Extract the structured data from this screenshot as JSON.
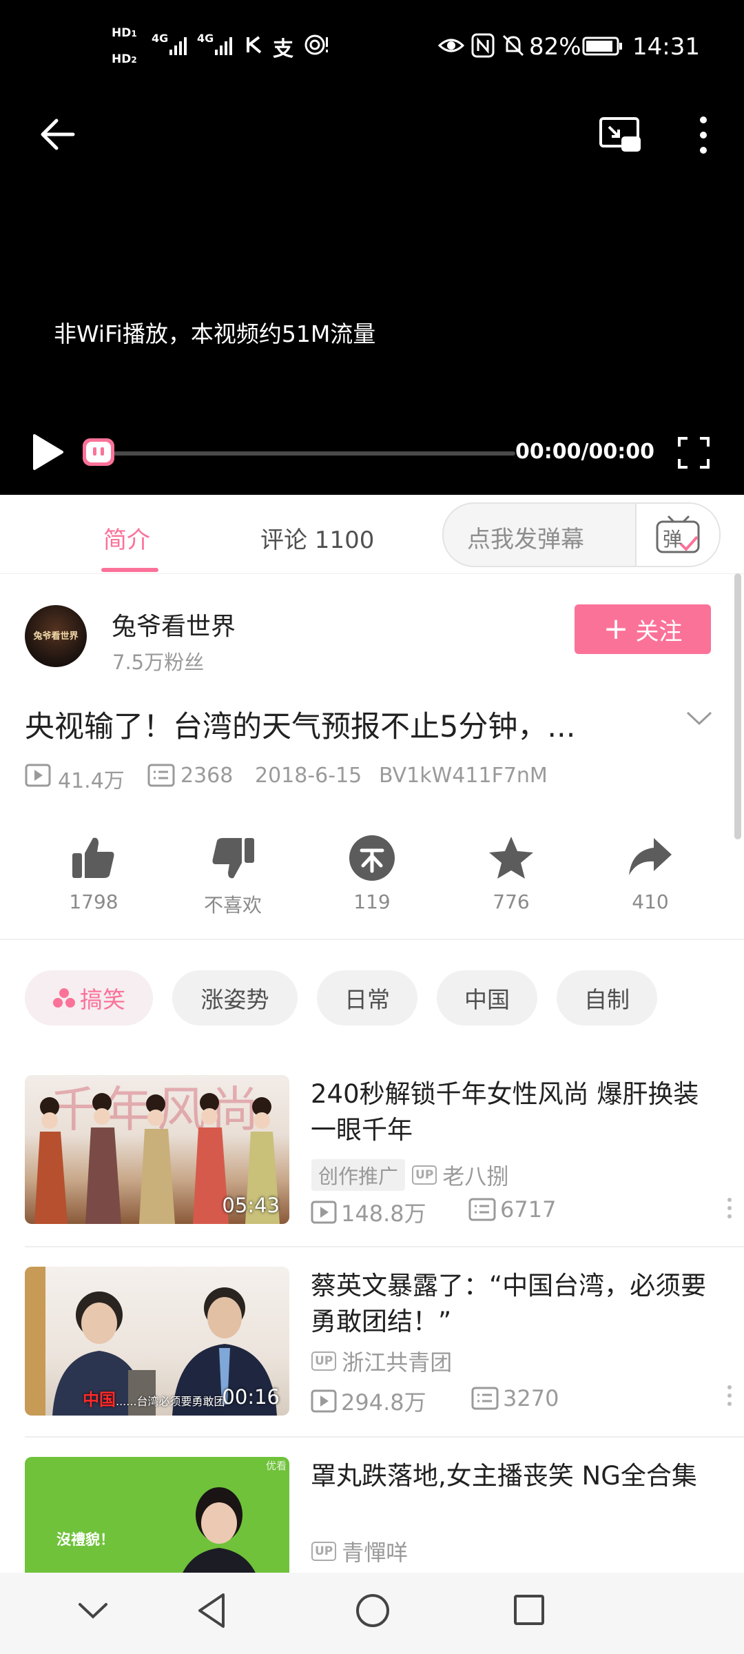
{
  "status_bar": {
    "network_1": "4G",
    "network_2": "4G",
    "battery": "82%",
    "time": "14:31"
  },
  "player": {
    "notice": "非WiFi播放，本视频约51M流量",
    "time": "00:00/00:00",
    "progress": 0
  },
  "tabs": {
    "intro": "简介",
    "comments": "评论 1100"
  },
  "danmaku": {
    "placeholder": "点我发弹幕",
    "button_label": "弹"
  },
  "uploader": {
    "avatar_text": "兔爷看世界",
    "name": "兔爷看世界",
    "fans": "7.5万粉丝",
    "follow_label": "关注"
  },
  "video": {
    "title": "央视输了！台湾的天气预报不止5分钟，...",
    "views": "41.4万",
    "danmaku_count": "2368",
    "date": "2018-6-15",
    "bvid": "BV1kW411F7nM"
  },
  "actions": {
    "like": "1798",
    "dislike": "不喜欢",
    "coin": "119",
    "favorite": "776",
    "share": "410"
  },
  "tags": [
    "搞笑",
    "涨姿势",
    "日常",
    "中国",
    "自制"
  ],
  "related": [
    {
      "title": "240秒解锁千年女性风尚 爆肝换装一眼千年",
      "promo": "创作推广",
      "up_badge": "UP",
      "uploader": "老八捌",
      "views": "148.8万",
      "comments": "6717",
      "duration": "05:43",
      "thumb_text": "千年风尚"
    },
    {
      "title": "蔡英文暴露了：“中国台湾，必须要勇敢团结！”",
      "up_badge": "UP",
      "uploader": "浙江共青团",
      "views": "294.8万",
      "comments": "3270",
      "duration": "00:16",
      "thumb_caption_red": "中国",
      "thumb_caption": "......台湾必须要勇敢团"
    },
    {
      "title": "罩丸跌落地,女主播丧笑 NG全合集",
      "up_badge": "UP",
      "uploader": "青憚咩",
      "thumb_text": "沒禮貌！",
      "thumb_corner": "优看"
    }
  ],
  "colors": {
    "accent": "#fb7299",
    "player_bg": "#000000",
    "muted_text": "#9a9a9a"
  }
}
